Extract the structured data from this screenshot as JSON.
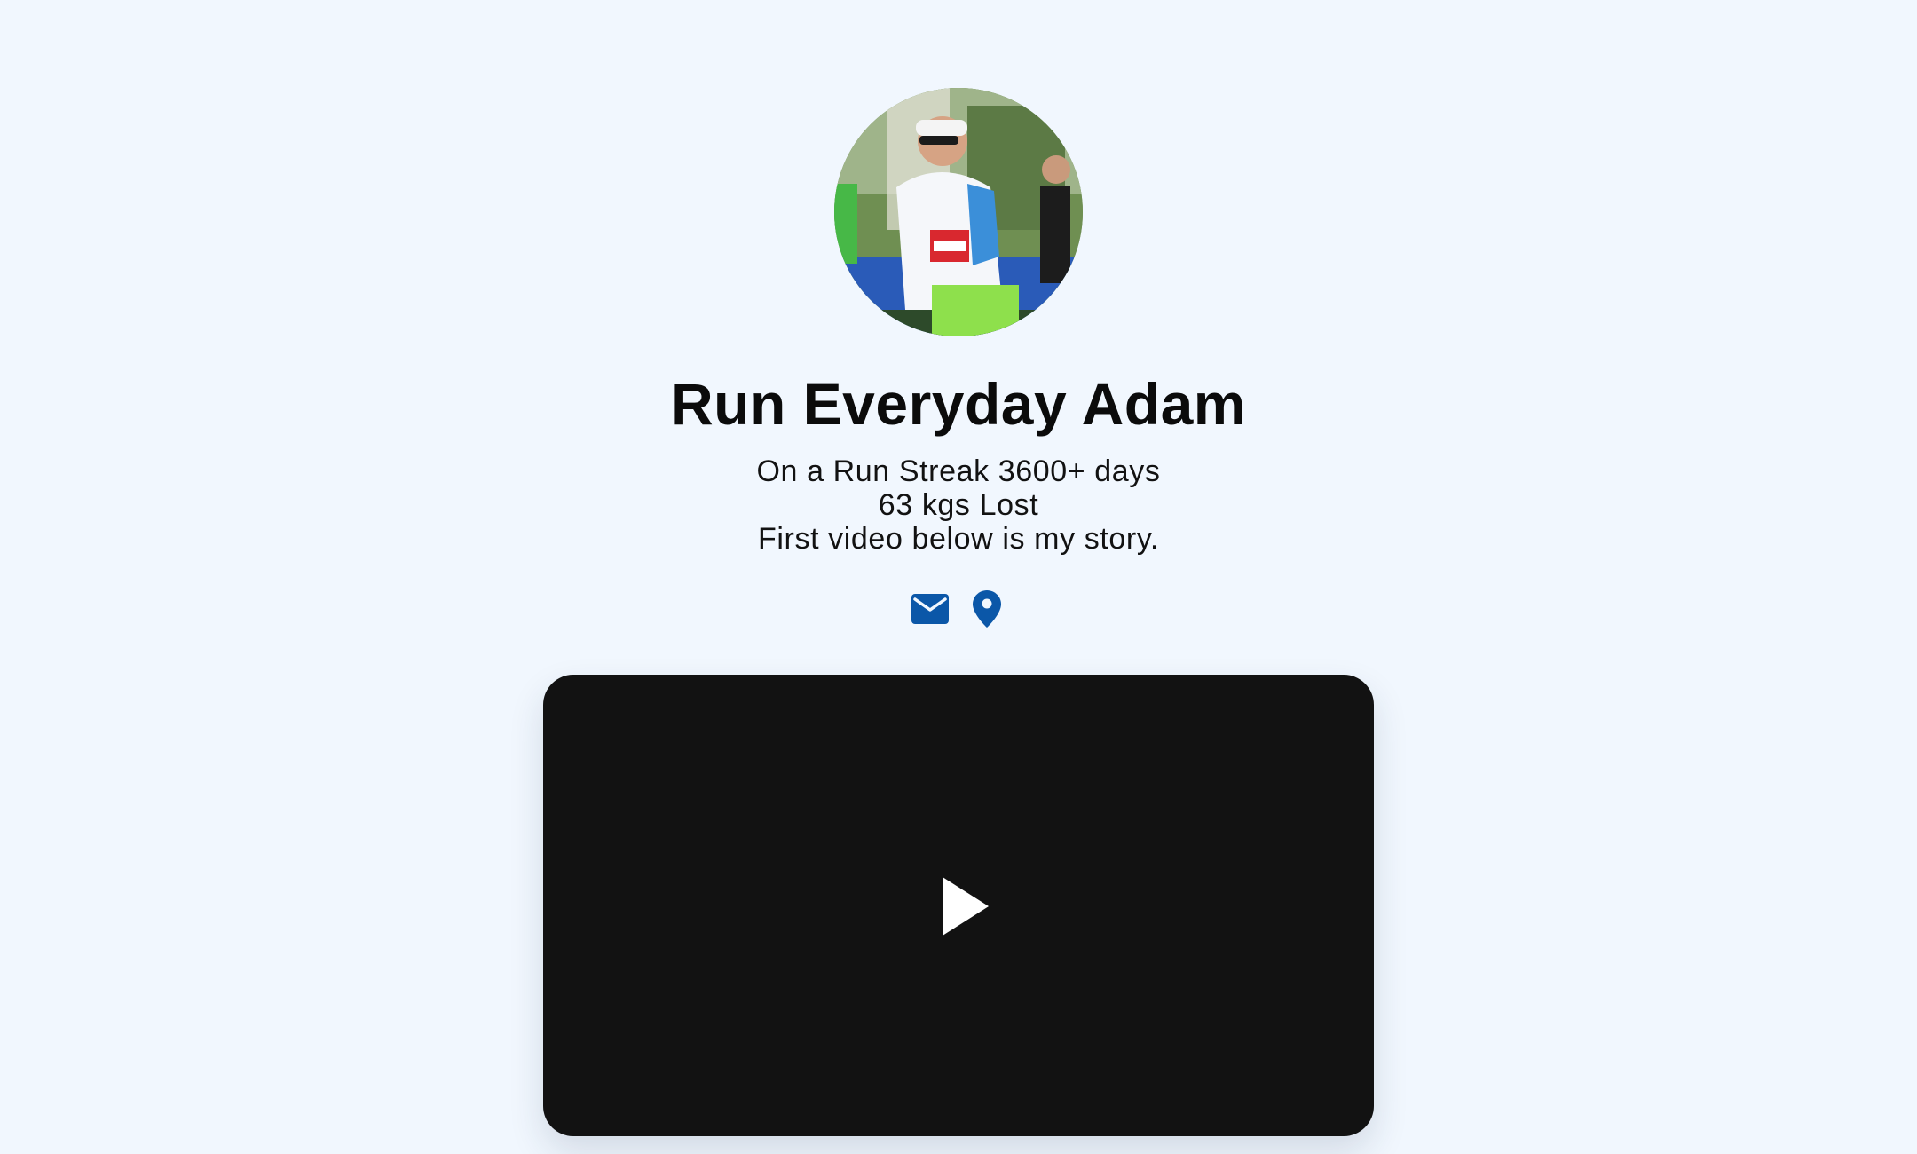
{
  "profile": {
    "name": "Run Everyday Adam",
    "bio_lines": [
      "On a Run Streak 3600+ days",
      "63 kgs Lost",
      "First video below is my story."
    ],
    "avatar_icon": "avatar-photo-runner"
  },
  "socials": [
    {
      "icon": "envelope-icon",
      "color": "#0b57a8"
    },
    {
      "icon": "map-pin-icon",
      "color": "#0b57a8"
    }
  ],
  "video": {
    "icon": "play-icon",
    "background_color": "#121212"
  },
  "theme": {
    "background": "#f1f7fe",
    "accent": "#0b57a8",
    "text": "#0b0b0b"
  }
}
